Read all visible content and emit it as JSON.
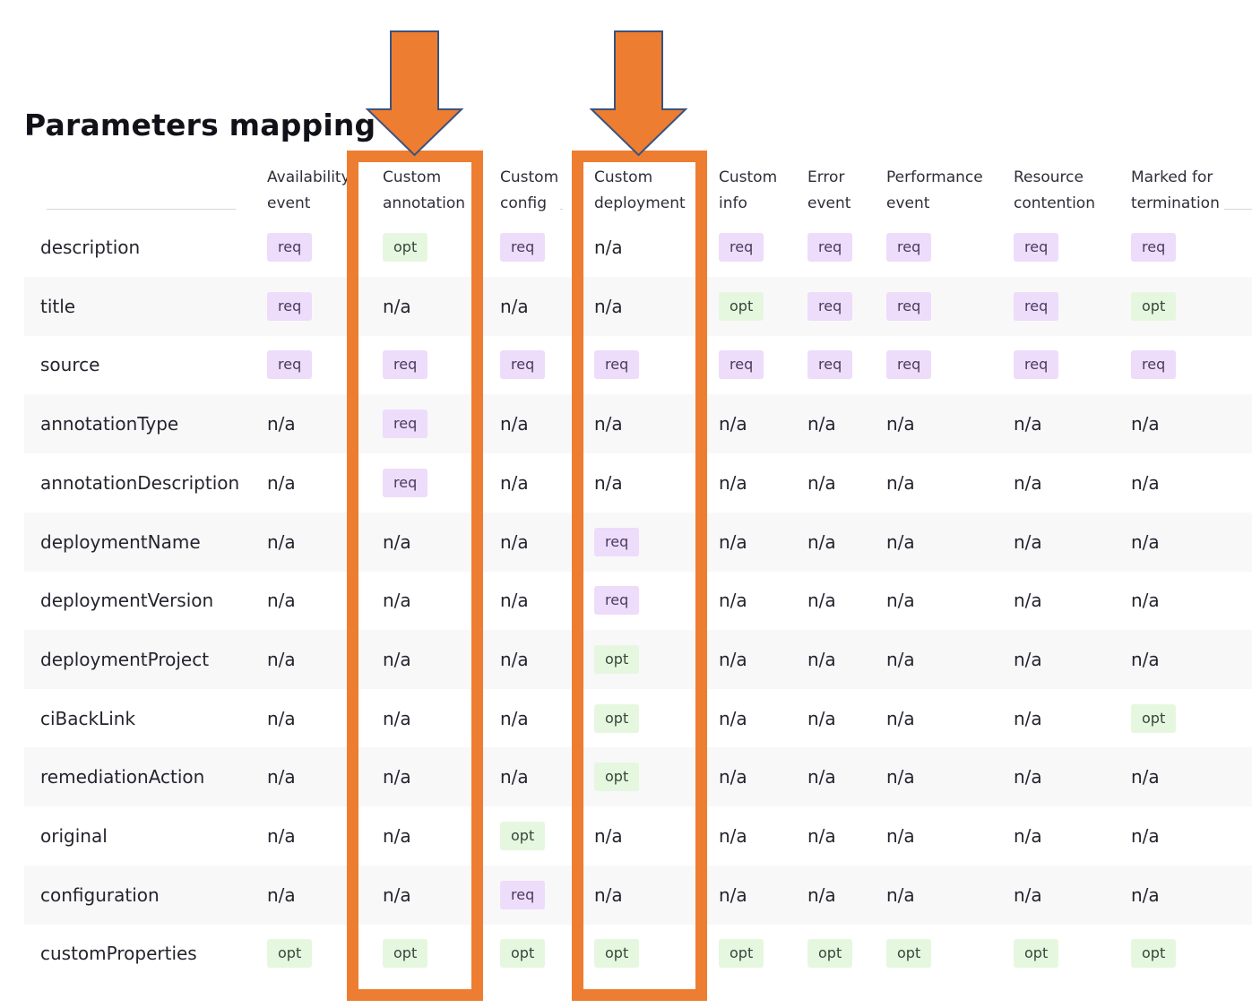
{
  "title": "Parameters mapping",
  "colors": {
    "highlight": "#ed7d31",
    "req_badge": "#eedcfb",
    "opt_badge": "#e6f7df",
    "alt_row": "#f8f8f9"
  },
  "icons": {
    "highlight_arrow": "arrow-down-icon"
  },
  "columns": [
    {
      "line1": "Availability",
      "line2": "event"
    },
    {
      "line1": "Custom",
      "line2": "annotation"
    },
    {
      "line1": "Custom",
      "line2": "config"
    },
    {
      "line1": "Custom",
      "line2": "deployment"
    },
    {
      "line1": "Custom",
      "line2": "info"
    },
    {
      "line1": "Error",
      "line2": "event"
    },
    {
      "line1": "Performance",
      "line2": "event"
    },
    {
      "line1": "Resource",
      "line2": "contention"
    },
    {
      "line1": "Marked for",
      "line2": "termination"
    }
  ],
  "rows": [
    {
      "label": "description",
      "values": [
        "req",
        "opt",
        "req",
        "n/a",
        "req",
        "req",
        "req",
        "req",
        "req"
      ]
    },
    {
      "label": "title",
      "values": [
        "req",
        "n/a",
        "n/a",
        "n/a",
        "opt",
        "req",
        "req",
        "req",
        "opt"
      ]
    },
    {
      "label": "source",
      "values": [
        "req",
        "req",
        "req",
        "req",
        "req",
        "req",
        "req",
        "req",
        "req"
      ]
    },
    {
      "label": "annotationType",
      "values": [
        "n/a",
        "req",
        "n/a",
        "n/a",
        "n/a",
        "n/a",
        "n/a",
        "n/a",
        "n/a"
      ]
    },
    {
      "label": "annotationDescription",
      "values": [
        "n/a",
        "req",
        "n/a",
        "n/a",
        "n/a",
        "n/a",
        "n/a",
        "n/a",
        "n/a"
      ]
    },
    {
      "label": "deploymentName",
      "values": [
        "n/a",
        "n/a",
        "n/a",
        "req",
        "n/a",
        "n/a",
        "n/a",
        "n/a",
        "n/a"
      ]
    },
    {
      "label": "deploymentVersion",
      "values": [
        "n/a",
        "n/a",
        "n/a",
        "req",
        "n/a",
        "n/a",
        "n/a",
        "n/a",
        "n/a"
      ]
    },
    {
      "label": "deploymentProject",
      "values": [
        "n/a",
        "n/a",
        "n/a",
        "opt",
        "n/a",
        "n/a",
        "n/a",
        "n/a",
        "n/a"
      ]
    },
    {
      "label": "ciBackLink",
      "values": [
        "n/a",
        "n/a",
        "n/a",
        "opt",
        "n/a",
        "n/a",
        "n/a",
        "n/a",
        "opt"
      ]
    },
    {
      "label": "remediationAction",
      "values": [
        "n/a",
        "n/a",
        "n/a",
        "opt",
        "n/a",
        "n/a",
        "n/a",
        "n/a",
        "n/a"
      ]
    },
    {
      "label": "original",
      "values": [
        "n/a",
        "n/a",
        "opt",
        "n/a",
        "n/a",
        "n/a",
        "n/a",
        "n/a",
        "n/a"
      ]
    },
    {
      "label": "configuration",
      "values": [
        "n/a",
        "n/a",
        "req",
        "n/a",
        "n/a",
        "n/a",
        "n/a",
        "n/a",
        "n/a"
      ]
    },
    {
      "label": "customProperties",
      "values": [
        "opt",
        "opt",
        "opt",
        "opt",
        "opt",
        "opt",
        "opt",
        "opt",
        "opt"
      ]
    }
  ]
}
